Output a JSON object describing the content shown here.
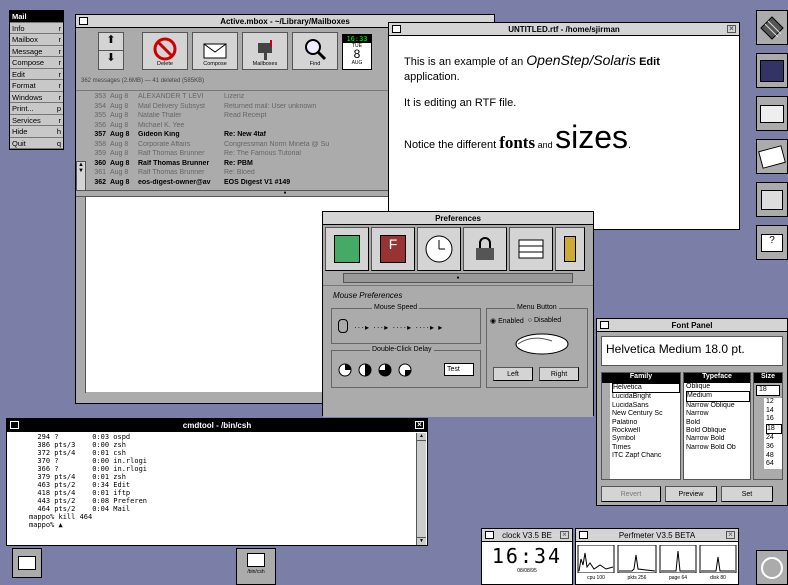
{
  "menu": {
    "title": "Mail",
    "items": [
      {
        "label": "Info",
        "key": "r"
      },
      {
        "label": "Mailbox",
        "key": "r"
      },
      {
        "label": "Message",
        "key": "r"
      },
      {
        "label": "Compose",
        "key": "r"
      },
      {
        "label": "Edit",
        "key": "r"
      },
      {
        "label": "Format",
        "key": "r"
      },
      {
        "label": "Windows",
        "key": "r"
      },
      {
        "label": "Print...",
        "key": "p"
      },
      {
        "label": "Services",
        "key": "r"
      },
      {
        "label": "Hide",
        "key": "h"
      },
      {
        "label": "Quit",
        "key": "q"
      }
    ]
  },
  "mail": {
    "title": "Active.mbox - ~/Library/Mailboxes",
    "buttons": [
      "Delete",
      "Compose",
      "Mailboxes",
      "Find"
    ],
    "clock": {
      "time": "16:33",
      "day": "TUE",
      "date": "8",
      "month": "AUG"
    },
    "summary": "362 messages (2.6MB) — 41 deleted (585KB)",
    "rows": [
      {
        "num": "353",
        "date": "Aug 8",
        "from": "ALEXANDER T LEVI",
        "subject": "Lizenz",
        "bold": false
      },
      {
        "num": "354",
        "date": "Aug 8",
        "from": "Mail Delivery Subsyst",
        "subject": "Returned mail: User unknown",
        "bold": false
      },
      {
        "num": "355",
        "date": "Aug 8",
        "from": "Natalie Thaler",
        "subject": "Read Receipt",
        "bold": false
      },
      {
        "num": "356",
        "date": "Aug 8",
        "from": "Michael K. Yee",
        "subject": "",
        "bold": false
      },
      {
        "num": "357",
        "date": "Aug 8",
        "from": "Gideon King",
        "subject": "Re: New 4taf",
        "bold": true
      },
      {
        "num": "358",
        "date": "Aug 8",
        "from": "Corporate Affairs",
        "subject": "Congressman Norm Mineta @ Su",
        "bold": false
      },
      {
        "num": "359",
        "date": "Aug 8",
        "from": "Ralf Thomas Brunner",
        "subject": "Re: The Famous Tutorial",
        "bold": false
      },
      {
        "num": "360",
        "date": "Aug 8",
        "from": "Ralf Thomas Brunner",
        "subject": "Re: PBM",
        "bold": true
      },
      {
        "num": "361",
        "date": "Aug 8",
        "from": "Ralf Thomas Brunner",
        "subject": "Re: Bloed",
        "bold": false
      },
      {
        "num": "362",
        "date": "Aug 8",
        "from": "eos-digest-owner@av",
        "subject": "EOS Digest V1 #149",
        "bold": true
      }
    ]
  },
  "editor": {
    "title": "UNTITLED.rtf - /home/sjirman",
    "line1a": "This is an example of an ",
    "line1b": "OpenStep/Solaris",
    "line1c": " Edit",
    "line1d": "application.",
    "line2": "It is editing an RTF file.",
    "line3a": "Notice the different ",
    "line3b": "fonts",
    "line3c": " and ",
    "line3d": "sizes",
    "line3e": "."
  },
  "prefs": {
    "title": "Preferences",
    "section": "Mouse Preferences",
    "mouse_speed": "Mouse Speed",
    "menu_button": "Menu Button",
    "enabled": "Enabled",
    "disabled": "Disabled",
    "double_click": "Double-Click Delay",
    "test": "Test",
    "left": "Left",
    "right": "Right"
  },
  "fontpanel": {
    "title": "Font Panel",
    "preview": "Helvetica Medium 18.0 pt.",
    "headers": [
      "Family",
      "Typeface",
      "Size"
    ],
    "families": [
      "Helvetica",
      "LucidaBright",
      "LucidaSans",
      "New Century Sc",
      "Palatino",
      "Rockwell",
      "Symbol",
      "Times",
      "ITC Zapf Chanc"
    ],
    "typefaces": [
      "Oblique",
      "Medium",
      "Narrow Oblique",
      "Narrow",
      "Bold",
      "Bold Oblique",
      "Narrow Bold",
      "Narrow Bold Ob"
    ],
    "size_value": "18",
    "sizes": [
      "12",
      "14",
      "16",
      "18",
      "24",
      "36",
      "48",
      "64"
    ],
    "revert": "Revert",
    "preview_btn": "Preview",
    "set": "Set"
  },
  "cmdtool": {
    "title": "cmdtool - /bin/csh",
    "lines": [
      "  294 ?        0:03 ospd",
      "  386 pts/3    0:00 zsh",
      "  372 pts/4    0:01 csh",
      "  370 ?        0:00 in.rlogi",
      "  366 ?        0:00 in.rlogi",
      "  379 pts/4    0:01 zsh",
      "  463 pts/2    0:34 Edit",
      "  418 pts/4    0:01 iftp",
      "  443 pts/2    0:08 Preferen",
      "  464 pts/2    0:04 Mail",
      "mappo% kill 464",
      "mappo% ▲"
    ]
  },
  "clock": {
    "title": "clock V3.5 BE",
    "time": "16:34",
    "date": "08/08/95"
  },
  "perfmeter": {
    "title": "Perfmeter V3.5 BETA",
    "labels": [
      "cpu 100",
      "pkts 256",
      "page 64",
      "disk 80"
    ]
  },
  "dock_icon_label": "/bin/csh"
}
